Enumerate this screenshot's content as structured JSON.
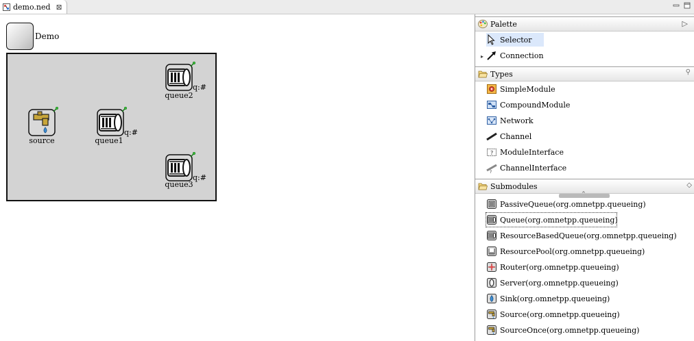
{
  "tab": {
    "title": "demo.ned"
  },
  "network": {
    "name": "Demo"
  },
  "modules": {
    "queue2": {
      "name": "queue2",
      "gate": "q:#"
    },
    "source": {
      "name": "source"
    },
    "queue1": {
      "name": "queue1",
      "gate": "q:#"
    },
    "queue3": {
      "name": "queue3",
      "gate": "q:#"
    }
  },
  "palette": {
    "title": "Palette",
    "tools": [
      {
        "label": "Selector",
        "icon": "arrow-pointer-icon"
      },
      {
        "label": "Connection",
        "icon": "connection-arrow-icon"
      }
    ]
  },
  "types": {
    "title": "Types",
    "items": [
      {
        "label": "SimpleModule",
        "icon": "simple-module-icon"
      },
      {
        "label": "CompoundModule",
        "icon": "compound-module-icon"
      },
      {
        "label": "Network",
        "icon": "network-icon"
      },
      {
        "label": "Channel",
        "icon": "channel-icon"
      },
      {
        "label": "ModuleInterface",
        "icon": "module-interface-icon"
      },
      {
        "label": "ChannelInterface",
        "icon": "channel-interface-icon"
      }
    ]
  },
  "submodules": {
    "title": "Submodules",
    "items": [
      {
        "label": "PassiveQueue(org.omnetpp.queueing)",
        "icon": "passive-queue-icon"
      },
      {
        "label": "Queue(org.omnetpp.queueing)",
        "icon": "queue-icon"
      },
      {
        "label": "ResourceBasedQueue(org.omnetpp.queueing)",
        "icon": "resource-queue-icon"
      },
      {
        "label": "ResourcePool(org.omnetpp.queueing)",
        "icon": "resource-pool-icon"
      },
      {
        "label": "Router(org.omnetpp.queueing)",
        "icon": "router-icon"
      },
      {
        "label": "Server(org.omnetpp.queueing)",
        "icon": "server-icon"
      },
      {
        "label": "Sink(org.omnetpp.queueing)",
        "icon": "sink-icon"
      },
      {
        "label": "Source(org.omnetpp.queueing)",
        "icon": "source-icon"
      },
      {
        "label": "SourceOnce(org.omnetpp.queueing)",
        "icon": "source-once-icon"
      }
    ]
  }
}
